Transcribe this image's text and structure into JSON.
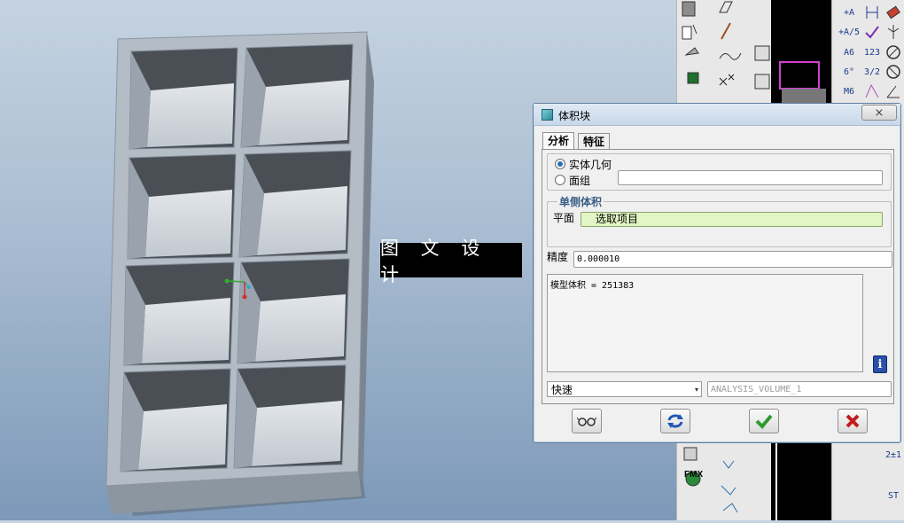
{
  "watermark": {
    "text": "图 文 设 计"
  },
  "dialog": {
    "title": "体积块",
    "close_glyph": "⨯",
    "tabs": [
      {
        "label": "分析",
        "active": true
      },
      {
        "label": "特征",
        "active": false
      }
    ],
    "geometry_options": [
      {
        "label": "实体几何",
        "selected": true
      },
      {
        "label": "面组",
        "selected": false
      }
    ],
    "one_side_group": {
      "title": "单侧体积",
      "plane_label": "平面",
      "plane_value": "选取项目"
    },
    "precision": {
      "label": "精度",
      "value": "0.000010"
    },
    "result_text": "模型体积 = 251383",
    "mode": {
      "value": "快速",
      "arrow": "▾"
    },
    "analysis_name": "ANALYSIS_VOLUME_1",
    "info_glyph": "i",
    "buttons": [
      {
        "name": "preview-button",
        "icon": "glasses-icon"
      },
      {
        "name": "repeat-button",
        "icon": "refresh-arrows-icon"
      },
      {
        "name": "ok-button",
        "icon": "checkmark-icon"
      },
      {
        "name": "cancel-button",
        "icon": "red-x-icon"
      }
    ]
  },
  "toolbar_labels": {
    "right1": [
      "+A",
      "+A/5",
      "A6",
      "6°",
      "M6"
    ],
    "right2": [
      "123",
      "3/2"
    ],
    "right3": [
      "2±1",
      "ST"
    ],
    "fmx": "FMX"
  },
  "colors": {
    "accent_blue": "#2b6fb3",
    "select_green": "#e2f5c4",
    "ok_green": "#2f9a2f",
    "cancel_red": "#c21d1d",
    "tray_gray": "#a9b2bc"
  }
}
